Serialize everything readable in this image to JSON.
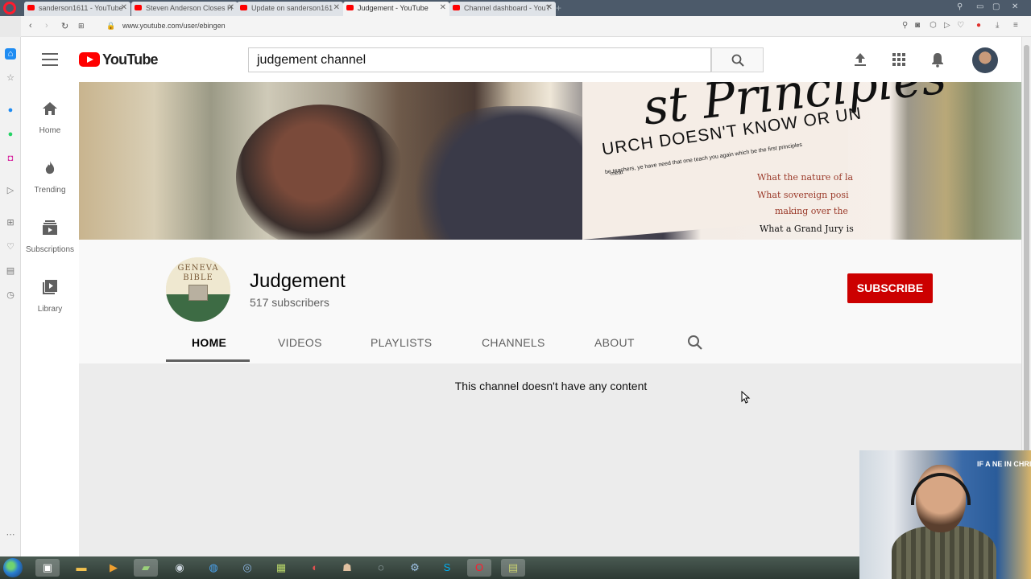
{
  "browser": {
    "tabs": [
      {
        "title": "sanderson1611 - YouTube",
        "active": false
      },
      {
        "title": "Steven Anderson Closes H",
        "active": false
      },
      {
        "title": "Update on sanderson161",
        "active": false
      },
      {
        "title": "Judgement - YouTube",
        "active": true
      },
      {
        "title": "Channel dashboard - YouT",
        "active": false
      }
    ],
    "url": "www.youtube.com/user/ebingen"
  },
  "youtube": {
    "logo_text": "YouTube",
    "search": {
      "value": "judgement channel"
    },
    "guide": [
      {
        "label": "Home",
        "icon": "home-icon"
      },
      {
        "label": "Trending",
        "icon": "trending-icon"
      },
      {
        "label": "Subscriptions",
        "icon": "subscriptions-icon"
      },
      {
        "label": "Library",
        "icon": "library-icon"
      }
    ],
    "banner": {
      "text_script": "st Principles",
      "text_headline": "URCH DOESN'T KNOW OR UN",
      "text_small_1": "be teachers, ye have need that one teach you again which be the first principles",
      "text_small_2": "meat",
      "text_red_1": "What the nature of la",
      "text_red_2": "What sovereign posi",
      "text_red_3": "making over the",
      "text_black": "What a Grand Jury is"
    },
    "channel": {
      "name": "Judgement",
      "subscribers": "517 subscribers",
      "avatar_text_1": "GENEVA",
      "avatar_text_2": "BIBLE",
      "subscribe_label": "SUBSCRIBE",
      "tabs": [
        "HOME",
        "VIDEOS",
        "PLAYLISTS",
        "CHANNELS",
        "ABOUT"
      ],
      "active_tab": "HOME"
    },
    "content": {
      "empty_message": "This channel doesn't have any content"
    }
  },
  "webcam": {
    "sign_text": "IF A    NE IN CHRIST..."
  },
  "colors": {
    "brand": "#ff0000",
    "subscribe": "#cc0000"
  }
}
